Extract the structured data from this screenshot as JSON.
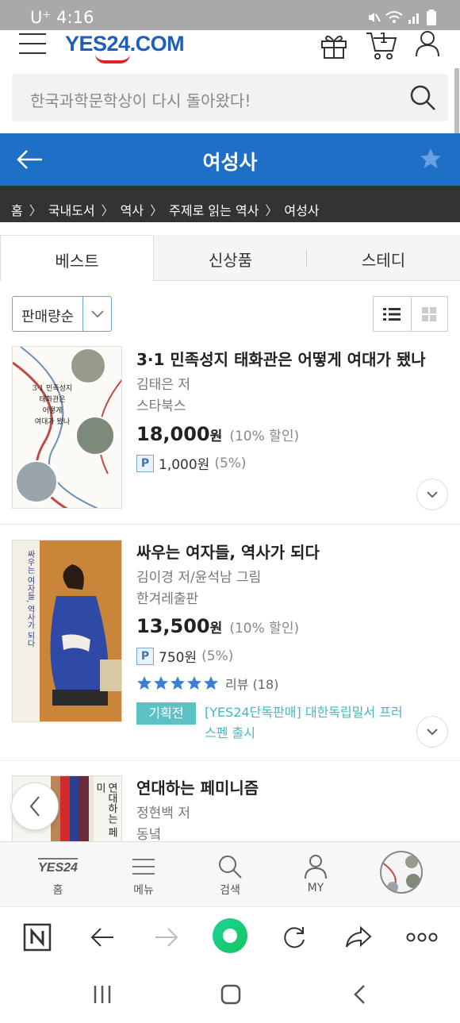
{
  "status_bar": {
    "carrier": "U⁺",
    "time": "4:16"
  },
  "header": {
    "logo_text": "YES24",
    "logo_suffix": ".COM",
    "cart_count": "1",
    "icons": [
      "menu-icon",
      "gift-icon",
      "cart-icon",
      "user-icon"
    ]
  },
  "search": {
    "placeholder": "한국과학문학상이 다시 돌아왔다!"
  },
  "title_bar": {
    "title": "여성사"
  },
  "breadcrumb": [
    "홈",
    "국내도서",
    "역사",
    "주제로 읽는 역사",
    "여성사"
  ],
  "tabs": [
    {
      "label": "베스트",
      "active": true
    },
    {
      "label": "신상품",
      "active": false
    },
    {
      "label": "스테디",
      "active": false
    }
  ],
  "sort": {
    "selected": "판매량순"
  },
  "books": [
    {
      "title": "3·1 민족성지 태화관은 어떻게 여대가 됐나",
      "author": "김태은 저",
      "publisher": "스타북스",
      "price": "18,000",
      "currency": "원",
      "discount": "(10% 할인)",
      "point_badge": "P",
      "points": "1,000원",
      "point_rate": "(5%)",
      "cover_lines": [
        "3·1 민족성지",
        "태화관은",
        "어떻게",
        "여대가 됐나"
      ]
    },
    {
      "title": "싸우는 여자들, 역사가 되다",
      "author": "김이경 저/윤석남 그림",
      "publisher": "한겨레출판",
      "price": "13,500",
      "currency": "원",
      "discount": "(10% 할인)",
      "point_badge": "P",
      "points": "750원",
      "point_rate": "(5%)",
      "review_label": "리뷰 (18)",
      "rating_stars": 5,
      "promo_badge": "기획전",
      "promo_text": "[YES24단독판매] 대한독립밀서 프러스펜 출시",
      "cover_lines": [
        "싸우는 여자들,",
        "역사가 되다"
      ]
    },
    {
      "title": "연대하는 페미니즘",
      "author": "정현백 저",
      "publisher": "동녘",
      "cover_lines": [
        "연대하는",
        "페미"
      ]
    }
  ],
  "bottom_nav": [
    {
      "label": "홈",
      "logo": "YES24"
    },
    {
      "label": "메뉴"
    },
    {
      "label": "검색"
    },
    {
      "label": "MY"
    }
  ],
  "colors": {
    "brand_blue": "#1e6fc6",
    "breadcrumb_bg": "#333333",
    "promo_teal": "#5cc2c4",
    "star_blue": "#3a7fd3"
  }
}
